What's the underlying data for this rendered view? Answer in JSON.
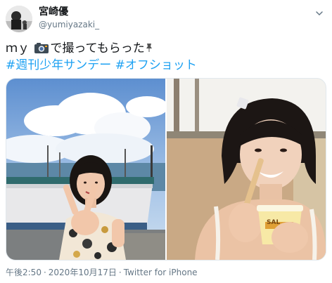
{
  "author": {
    "display_name": "宮崎優",
    "handle": "@yumiyazaki_",
    "avatar": "avatar-photo",
    "menu_icon": "chevron-down-icon"
  },
  "tweet": {
    "text_before_emoji": "ｍｙ ",
    "camera_emoji": "camera-emoji",
    "text_after_emoji": "で撮ってもらった",
    "pin_emoji": "pushpin-emoji",
    "hashtags": [
      "#週刊少年サンデー",
      "#オフショット"
    ]
  },
  "media": {
    "photo_count": 2,
    "left_photo": "photo-girl-peace-sign-boat",
    "right_photo": "photo-girl-ice-cream-spoon",
    "ice_cream_cup_text": "SAL"
  },
  "meta": {
    "time": "午後2:50",
    "separator": "·",
    "date": "2020年10月17日",
    "source": "Twitter for iPhone"
  },
  "colors": {
    "link": "#1da1f2",
    "secondary_text": "#657786",
    "primary_text": "#14171a"
  }
}
